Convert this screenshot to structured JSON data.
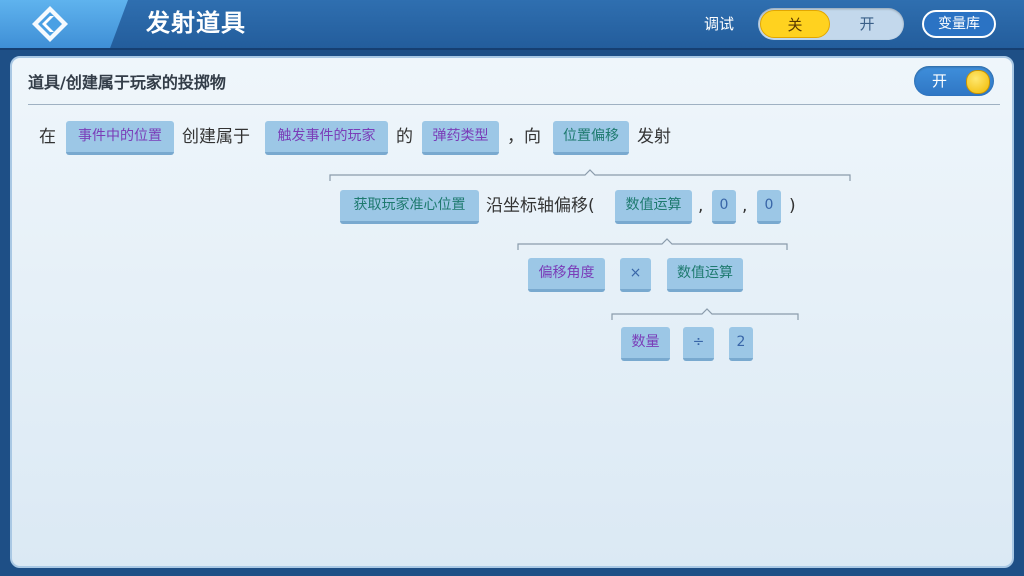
{
  "header": {
    "title": "发射道具",
    "debug_label": "调试",
    "debug_off": "关",
    "debug_on": "开",
    "variables_button": "变量库"
  },
  "panel": {
    "title": "道具/创建属于玩家的投掷物",
    "toggle_label": "开"
  },
  "line1": {
    "text_in": "在",
    "chip_position": "事件中的位置",
    "text_create": "创建属于",
    "chip_player": "触发事件的玩家",
    "text_of": "的",
    "chip_ammo": "弹药类型",
    "text_toward": "，向",
    "chip_offset": "位置偏移",
    "text_fire": "发射"
  },
  "line2": {
    "chip_crosshair": "获取玩家准心位置",
    "text_offset": "沿坐标轴偏移(",
    "chip_math": "数值运算",
    "comma1": ",",
    "chip_zero1": "0",
    "comma2": ",",
    "chip_zero2": "0",
    "close_paren": ")"
  },
  "line3": {
    "chip_angle": "偏移角度",
    "chip_times": "×",
    "chip_math": "数值运算"
  },
  "line4": {
    "chip_count": "数量",
    "chip_divide": "÷",
    "chip_two": "2"
  },
  "colors": {
    "accent_yellow": "#ffd21f",
    "header_blue": "#2f6fb0",
    "chip_bg": "#9cc7e6",
    "chip_text_purple": "#7a3db8",
    "chip_text_teal": "#1e7a6f"
  },
  "icons": {
    "back": "back-arrow-icon"
  }
}
